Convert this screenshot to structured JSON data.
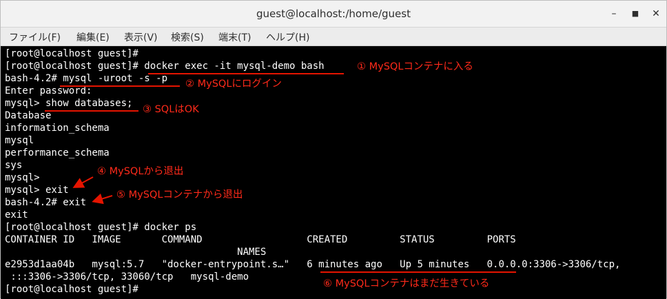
{
  "window": {
    "title": "guest@localhost:/home/guest",
    "minimize_glyph": "–",
    "maximize_glyph": "■",
    "close_glyph": "✕"
  },
  "menu": [
    "ファイル(F)",
    "編集(E)",
    "表示(V)",
    "検索(S)",
    "端末(T)",
    "ヘルプ(H)"
  ],
  "terminal": {
    "lines": [
      "[root@localhost guest]#",
      "[root@localhost guest]# docker exec -it mysql-demo bash",
      "bash-4.2# mysql -uroot -s -p",
      "Enter password:",
      "mysql> show databases;",
      "Database",
      "information_schema",
      "mysql",
      "performance_schema",
      "sys",
      "mysql>",
      "mysql> exit",
      "bash-4.2# exit",
      "exit",
      "[root@localhost guest]# docker ps",
      "CONTAINER ID   IMAGE       COMMAND                  CREATED         STATUS         PORTS",
      "                                        NAMES",
      "e2953d1aa04b   mysql:5.7   \"docker-entrypoint.s…\"   6 minutes ago   Up 5 minutes   0.0.0.0:3306->3306/tcp,",
      " :::3306->3306/tcp, 33060/tcp   mysql-demo",
      "[root@localhost guest]#"
    ]
  },
  "annotations": [
    "① MySQLコンテナに入る",
    "② MySQLにログイン",
    "③ SQLはOK",
    "④ MySQLから退出",
    "⑤ MySQLコンテナから退出",
    "⑥ MySQLコンテナはまだ生きている"
  ],
  "colors": {
    "terminal_bg": "#000000",
    "terminal_fg": "#ffffff",
    "annotation": "#ff2a1a"
  }
}
